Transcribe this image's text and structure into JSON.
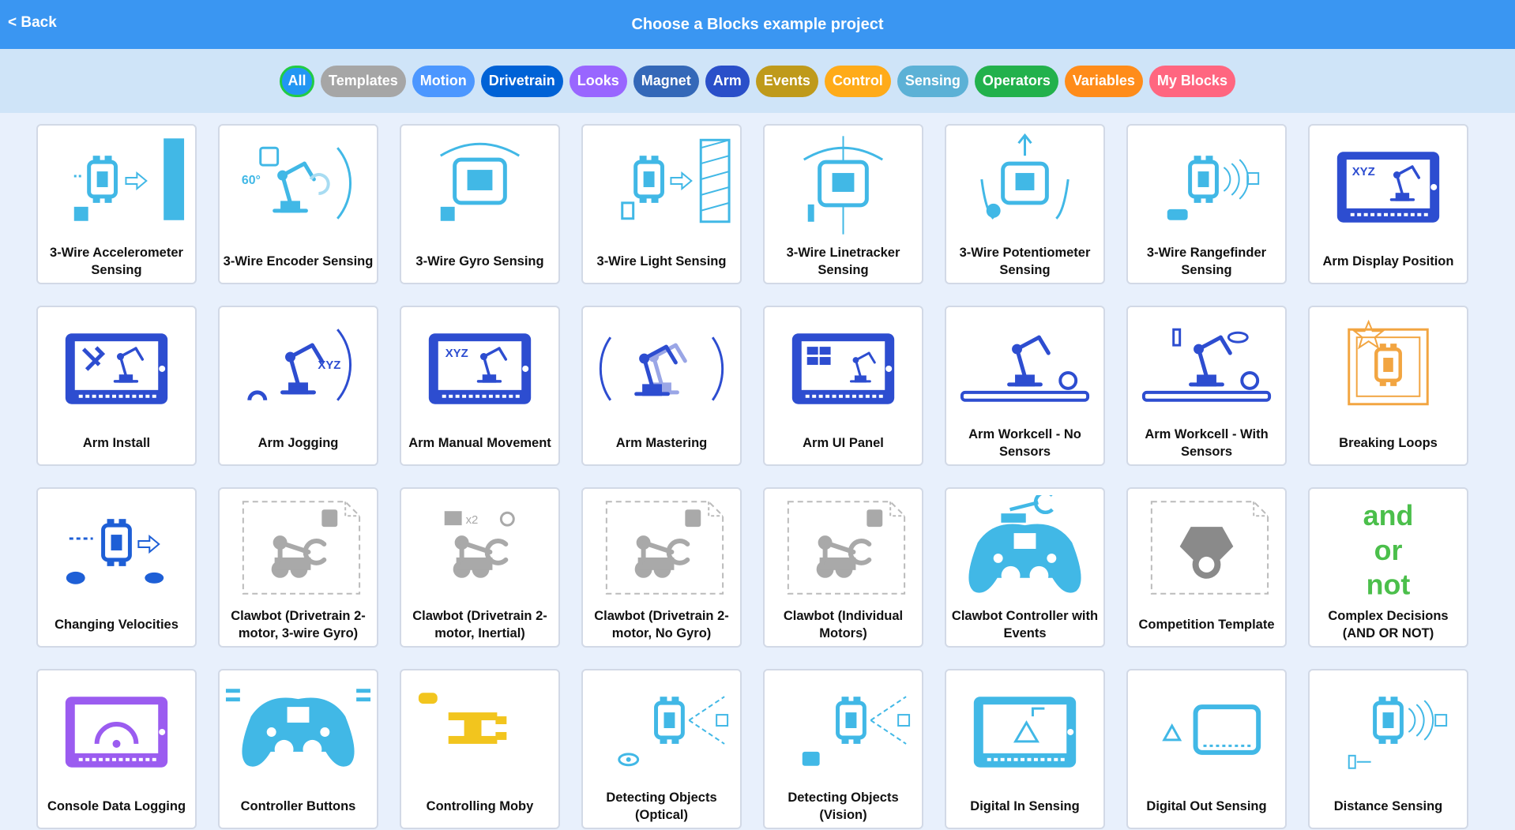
{
  "header": {
    "back_label": "< Back",
    "title": "Choose a Blocks example project"
  },
  "filters": [
    {
      "label": "All",
      "color": "#2196f3"
    },
    {
      "label": "Templates",
      "color": "#a6a6a6"
    },
    {
      "label": "Motion",
      "color": "#4c97ff"
    },
    {
      "label": "Drivetrain",
      "color": "#0062d6"
    },
    {
      "label": "Looks",
      "color": "#9966ff"
    },
    {
      "label": "Magnet",
      "color": "#3468b8"
    },
    {
      "label": "Arm",
      "color": "#2a4fc9"
    },
    {
      "label": "Events",
      "color": "#bf9a1b"
    },
    {
      "label": "Control",
      "color": "#ffab19"
    },
    {
      "label": "Sensing",
      "color": "#5cb1d6"
    },
    {
      "label": "Operators",
      "color": "#22b14c"
    },
    {
      "label": "Variables",
      "color": "#ff8c1a"
    },
    {
      "label": "My Blocks",
      "color": "#ff6680"
    }
  ],
  "projects": [
    {
      "label": "3-Wire Accelerometer Sensing",
      "icon": "accelerometer-icon"
    },
    {
      "label": "3-Wire Encoder Sensing",
      "icon": "encoder-icon"
    },
    {
      "label": "3-Wire Gyro Sensing",
      "icon": "gyro-icon"
    },
    {
      "label": "3-Wire Light Sensing",
      "icon": "light-sensor-icon"
    },
    {
      "label": "3-Wire Linetracker Sensing",
      "icon": "linetracker-icon"
    },
    {
      "label": "3-Wire Potentiometer Sensing",
      "icon": "potentiometer-icon"
    },
    {
      "label": "3-Wire Rangefinder Sensing",
      "icon": "rangefinder-icon"
    },
    {
      "label": "Arm Display Position",
      "icon": "arm-display-icon"
    },
    {
      "label": "Arm Install",
      "icon": "arm-install-icon"
    },
    {
      "label": "Arm Jogging",
      "icon": "arm-jogging-icon"
    },
    {
      "label": "Arm Manual Movement",
      "icon": "arm-manual-icon"
    },
    {
      "label": "Arm Mastering",
      "icon": "arm-mastering-icon"
    },
    {
      "label": "Arm UI Panel",
      "icon": "arm-ui-panel-icon"
    },
    {
      "label": "Arm Workcell - No Sensors",
      "icon": "arm-workcell-icon"
    },
    {
      "label": "Arm Workcell - With Sensors",
      "icon": "arm-workcell-sensors-icon"
    },
    {
      "label": "Breaking Loops",
      "icon": "breaking-loops-icon"
    },
    {
      "label": "Changing Velocities",
      "icon": "velocities-icon"
    },
    {
      "label": "Clawbot (Drivetrain 2-motor, 3-wire Gyro)",
      "icon": "clawbot-template-icon"
    },
    {
      "label": "Clawbot (Drivetrain 2-motor, Inertial)",
      "icon": "clawbot-inertial-icon"
    },
    {
      "label": "Clawbot (Drivetrain 2-motor, No Gyro)",
      "icon": "clawbot-template-icon"
    },
    {
      "label": "Clawbot (Individual Motors)",
      "icon": "clawbot-template-icon"
    },
    {
      "label": "Clawbot Controller with Events",
      "icon": "controller-clawbot-icon"
    },
    {
      "label": "Competition Template",
      "icon": "competition-icon"
    },
    {
      "label": "Complex Decisions (AND OR NOT)",
      "icon": "and-or-not-icon",
      "text_lines": [
        "and",
        "or",
        "not"
      ]
    },
    {
      "label": "Console Data Logging",
      "icon": "console-logging-icon"
    },
    {
      "label": "Controller Buttons",
      "icon": "controller-icon"
    },
    {
      "label": "Controlling Moby",
      "icon": "moby-icon"
    },
    {
      "label": "Detecting Objects (Optical)",
      "icon": "optical-icon"
    },
    {
      "label": "Detecting Objects (Vision)",
      "icon": "vision-icon"
    },
    {
      "label": "Digital In Sensing",
      "icon": "digital-in-icon"
    },
    {
      "label": "Digital Out Sensing",
      "icon": "digital-out-icon"
    },
    {
      "label": "Distance Sensing",
      "icon": "distance-icon"
    }
  ]
}
